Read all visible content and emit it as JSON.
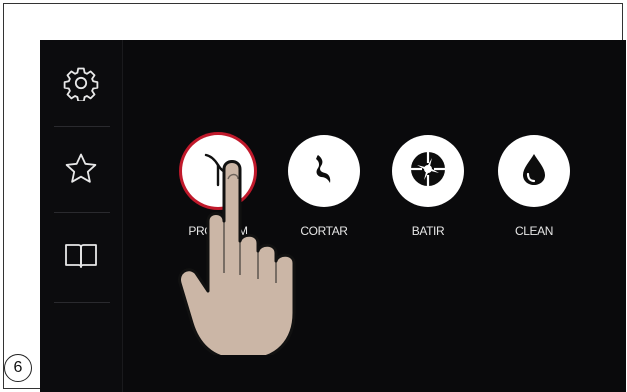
{
  "step_badge": "6",
  "sidebar": {
    "items": [
      {
        "icon": "gear-icon"
      },
      {
        "icon": "star-icon"
      },
      {
        "icon": "book-icon"
      }
    ]
  },
  "modes": [
    {
      "label": "PROGRAM",
      "icon": "blade-icon",
      "active": true
    },
    {
      "label": "CORTAR",
      "icon": "swirl-blade-icon",
      "active": false
    },
    {
      "label": "BATIR",
      "icon": "whisk-icon",
      "active": false
    },
    {
      "label": "CLEAN",
      "icon": "drop-icon",
      "active": false
    }
  ],
  "colors": {
    "screen_bg": "#0a0a0c",
    "active_ring": "#c0192b",
    "circle_bg": "#ffffff",
    "label_text": "#e6e6e6"
  },
  "overlay": {
    "icon": "pointing-hand-icon"
  }
}
